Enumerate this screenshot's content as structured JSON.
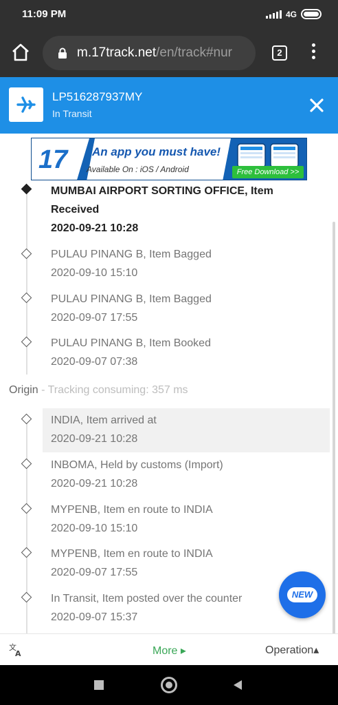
{
  "status_bar": {
    "time": "11:09 PM",
    "network": "4G",
    "icons": [
      "signal-icon",
      "battery-icon"
    ]
  },
  "browser": {
    "url_host": "m.17track.net",
    "url_path": "/en/track#nur",
    "tab_count": "2",
    "icons": [
      "home-icon",
      "lock-icon",
      "overflow-menu-icon"
    ]
  },
  "tracking_header": {
    "tracking_number": "LP516287937MY",
    "status": "In Transit",
    "accent": "#1e8fe6",
    "icons": [
      "airplane-icon",
      "close-icon"
    ]
  },
  "ad": {
    "logo_text": "17",
    "headline": "An app you must have!",
    "subline": "Available On : iOS / Android",
    "cta": "Free Download >>"
  },
  "destination_events": [
    {
      "line1": "MUMBAI AIRPORT SORTING OFFICE, Item",
      "line2": "Received",
      "datetime": "2020-09-21 10:28"
    },
    {
      "line1": "PULAU PINANG B, Item Bagged",
      "datetime": "2020-09-10 15:10"
    },
    {
      "line1": "PULAU PINANG B, Item Bagged",
      "datetime": "2020-09-07 17:55"
    },
    {
      "line1": "PULAU PINANG B, Item Booked",
      "datetime": "2020-09-07 07:38"
    }
  ],
  "origin": {
    "label": "Origin",
    "note": " - Tracking consuming: 357 ms"
  },
  "origin_events": [
    {
      "line1": "INDIA, Item arrived at",
      "datetime": "2020-09-21 10:28"
    },
    {
      "line1": "INBOMA, Held by customs (Import)",
      "datetime": "2020-09-21 10:28"
    },
    {
      "line1": "MYPENB, Item en route to INDIA",
      "datetime": "2020-09-10 15:10"
    },
    {
      "line1": "MYPENB, Item en route to INDIA",
      "datetime": "2020-09-07 17:55"
    },
    {
      "line1": "In Transit, Item posted over the counter",
      "datetime": "2020-09-07 15:37"
    }
  ],
  "fab": {
    "label": "NEW"
  },
  "toolbar": {
    "more": "More ▸",
    "operation": "Operation▴",
    "icons": [
      "translate-icon"
    ]
  },
  "nav_bar": {
    "icons": [
      "recents-square-icon",
      "home-circle-icon",
      "back-triangle-icon"
    ]
  }
}
